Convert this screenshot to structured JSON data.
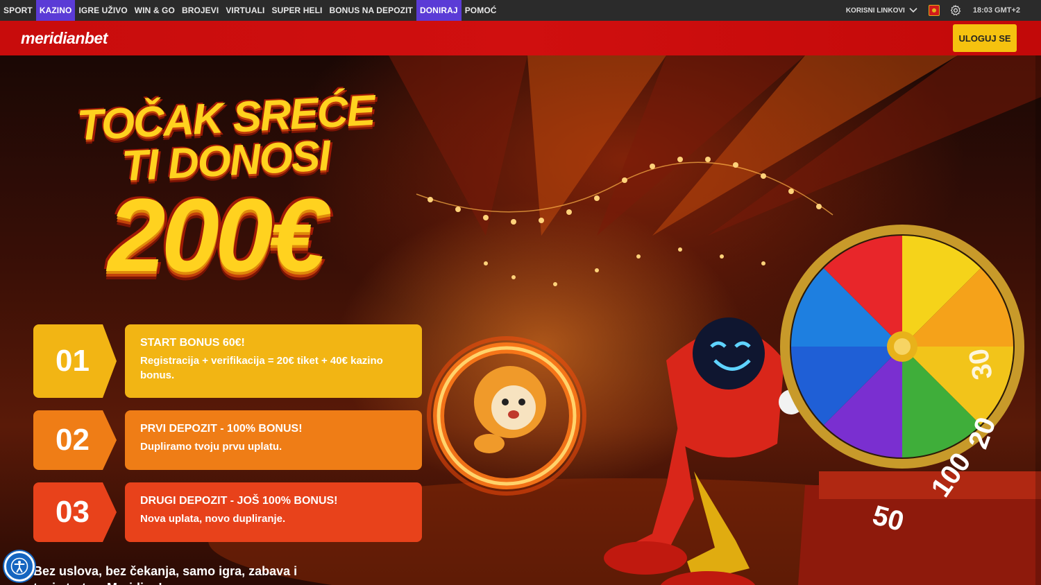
{
  "topnav": {
    "items": [
      {
        "label": "SPORT",
        "active": false
      },
      {
        "label": "KAZINO",
        "active": true
      },
      {
        "label": "IGRE UŽIVO",
        "active": false
      },
      {
        "label": "WIN & GO",
        "active": false
      },
      {
        "label": "BROJEVI",
        "active": false
      },
      {
        "label": "VIRTUALI",
        "active": false
      },
      {
        "label": "SUPER HELI",
        "active": false
      },
      {
        "label": "BONUS NA DEPOZIT",
        "active": false
      },
      {
        "label": "DONIRAJ",
        "active": true
      },
      {
        "label": "POMOĆ",
        "active": false
      }
    ],
    "links_label": "KORISNI LINKOVI",
    "time": "18:03 GMT+2"
  },
  "header": {
    "logo": "meridianbet",
    "login_label": "ULOGUJ SE"
  },
  "hero": {
    "title_line1": "TOČAK SREĆE",
    "title_line2": "TI DONOSI",
    "title_amount": "200€",
    "steps": [
      {
        "number": "01",
        "heading": "START BONUS 60€!",
        "text": "Registracija + verifikacija = 20€ tiket + 40€ kazino bonus."
      },
      {
        "number": "02",
        "heading": "PRVI DEPOZIT - 100% BONUS!",
        "text": "Dupliramo tvoju prvu uplatu."
      },
      {
        "number": "03",
        "heading": "DRUGI DEPOZIT - JOŠ 100% BONUS!",
        "text": "Nova uplata, novo dupliranje."
      }
    ],
    "tagline": "Bez uslova, bez čekanja, samo igra, zabava i tvoj start uz Meridian!",
    "wheel_labels": [
      "100",
      "50",
      "20",
      "30"
    ]
  },
  "colors": {
    "nav_bg": "#2b2b2b",
    "nav_active": "#5b3bd6",
    "header_red": "#d00f0f",
    "login_yellow": "#f5c20f",
    "step1": "#f2b514",
    "step2": "#ef7d16",
    "step3": "#e8421b"
  },
  "icons": [
    "chevron-down-icon",
    "flag-icon",
    "gear-icon",
    "accessibility-icon"
  ]
}
